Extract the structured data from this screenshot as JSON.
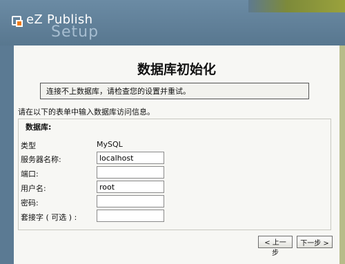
{
  "header": {
    "brand": "eZ Publish",
    "subtitle": "Setup"
  },
  "page": {
    "title": "数据库初始化",
    "error_message": "连接不上数据库，请检查您的设置并重试。",
    "intro_text": "请在以下的表单中输入数据库访问信息。"
  },
  "database": {
    "legend": "数据库:",
    "type_label": "类型",
    "type_value": "MySQL",
    "server_label": "服务器名称:",
    "server_value": "localhost",
    "port_label": "端口:",
    "port_value": "",
    "user_label": "用户名:",
    "user_value": "root",
    "password_label": "密码:",
    "password_value": "",
    "socket_label": "套接字 ( 可选 ) :",
    "socket_value": ""
  },
  "nav": {
    "back_label": "< 上一步",
    "next_label": "下一步 >"
  }
}
